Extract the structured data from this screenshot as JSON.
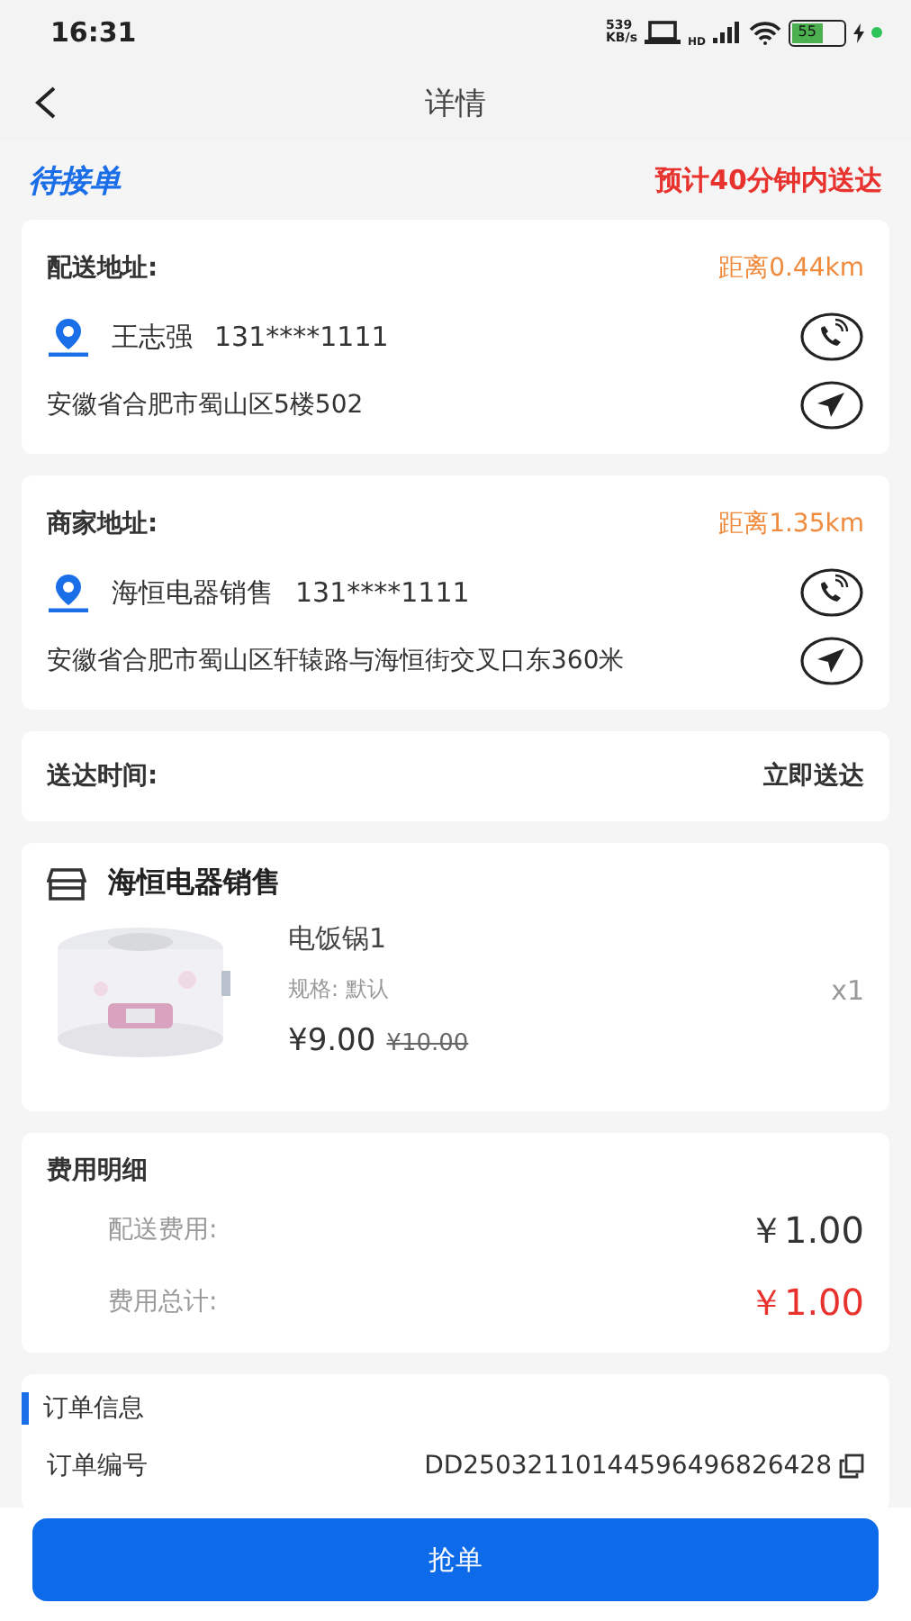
{
  "status_bar": {
    "time": "16:31",
    "net_speed": "539",
    "net_unit": "KB/s",
    "network_label": "HD",
    "battery": "55"
  },
  "nav": {
    "title": "详情"
  },
  "order_status": {
    "label": "待接单",
    "eta": "预计40分钟内送达"
  },
  "addresses": [
    {
      "title": "配送地址:",
      "distance": "距离0.44km",
      "name": "王志强",
      "phone": "131****1111",
      "address": "安徽省合肥市蜀山区5楼502"
    },
    {
      "title": "商家地址:",
      "distance": "距离1.35km",
      "name": "海恒电器销售",
      "phone": "131****1111",
      "address": "安徽省合肥市蜀山区轩辕路与海恒街交叉口东360米"
    }
  ],
  "delivery_time": {
    "label": "送达时间:",
    "value": "立即送达"
  },
  "shop": {
    "name": "海恒电器销售",
    "items": [
      {
        "name": "电饭锅1",
        "spec": "规格: 默认",
        "price": "¥9.00",
        "original_price": "¥10.00",
        "quantity": "x1",
        "kind": "picture"
      }
    ]
  },
  "fees": {
    "title": "费用明细",
    "rows": [
      {
        "label": "配送费用:",
        "value": "￥1.00",
        "kind": "normal"
      },
      {
        "label": "费用总计:",
        "value": "￥1.00",
        "kind": "total"
      }
    ]
  },
  "order_info": {
    "title": "订单信息",
    "rows": [
      {
        "label": "订单编号",
        "value": "DD25032110144596496826428"
      }
    ]
  },
  "action_button": "抢单"
}
